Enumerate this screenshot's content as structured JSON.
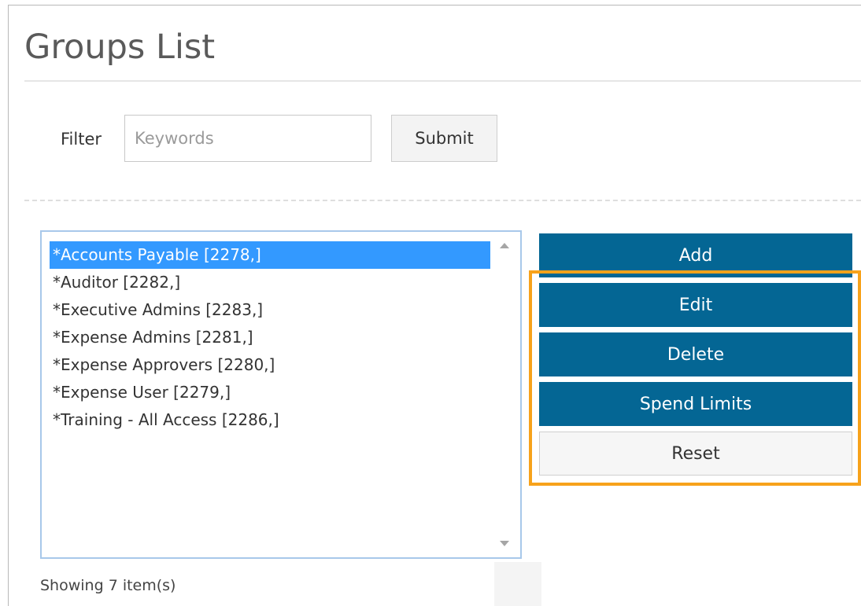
{
  "page": {
    "title": "Groups List"
  },
  "filter": {
    "label": "Filter",
    "placeholder": "Keywords",
    "value": "",
    "submit_label": "Submit"
  },
  "groups": {
    "items": [
      {
        "label": "*Accounts Payable [2278,]",
        "selected": true
      },
      {
        "label": "*Auditor [2282,]",
        "selected": false
      },
      {
        "label": "*Executive Admins [2283,]",
        "selected": false
      },
      {
        "label": "*Expense Admins [2281,]",
        "selected": false
      },
      {
        "label": "*Expense Approvers [2280,]",
        "selected": false
      },
      {
        "label": "*Expense User [2279,]",
        "selected": false
      },
      {
        "label": "*Training - All Access [2286,]",
        "selected": false
      }
    ],
    "showing": "Showing 7 item(s)"
  },
  "actions": {
    "add_label": "Add",
    "edit_label": "Edit",
    "delete_label": "Delete",
    "spend_limits_label": "Spend Limits",
    "reset_label": "Reset"
  },
  "colors": {
    "primary_button": "#046694",
    "selection": "#3399ff",
    "highlight": "#f7a21b"
  }
}
